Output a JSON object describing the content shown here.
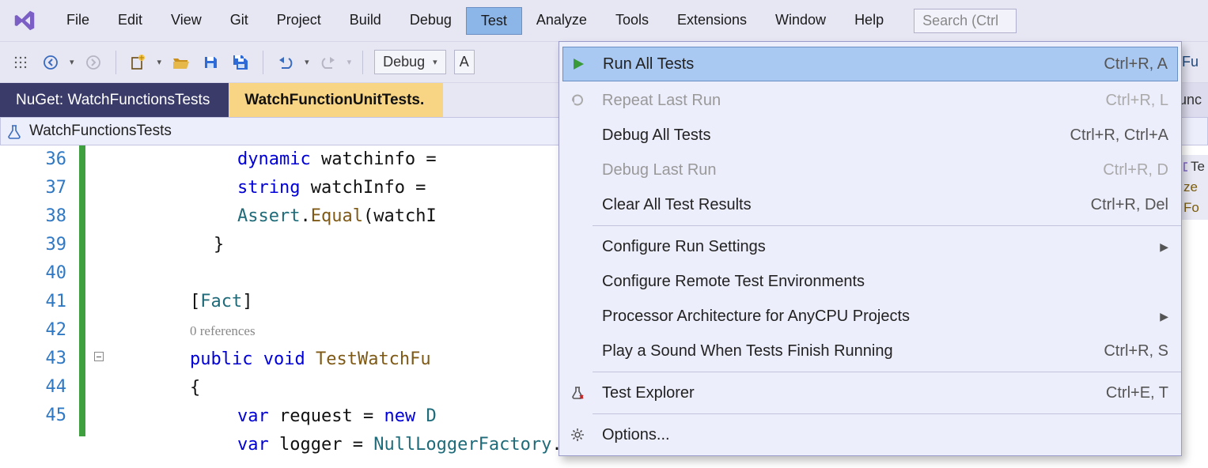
{
  "menubar": {
    "items": [
      "File",
      "Edit",
      "View",
      "Git",
      "Project",
      "Build",
      "Debug",
      "Test",
      "Analyze",
      "Tools",
      "Extensions",
      "Window",
      "Help"
    ],
    "activeIndex": 7,
    "searchPlaceholder": "Search (Ctrl"
  },
  "toolbar": {
    "config": "Debug"
  },
  "tabs": {
    "left": "NuGet: WatchFunctionsTests",
    "active": "WatchFunctionUnitTests.",
    "rightClipped": "unc"
  },
  "breadcrumb": {
    "text": "WatchFunctionsTests"
  },
  "rightPanel": {
    "l1": "Te",
    "l2": "ze",
    "l3": "Fo"
  },
  "editor": {
    "lines": [
      {
        "num": 36,
        "outline": "",
        "html": "<span class='kw'>dynamic</span> watchinfo ="
      },
      {
        "num": 37,
        "outline": "",
        "html": "<span class='kw'>string</span> watchInfo = "
      },
      {
        "num": 38,
        "outline": "",
        "html": "<span class='cls'>Assert</span>.<span class='call'>Equal</span>(watchI"
      },
      {
        "num": 39,
        "outline": "",
        "html": "}",
        "indent": -1
      },
      {
        "num": 40,
        "outline": "",
        "html": ""
      },
      {
        "num": 41,
        "outline": "",
        "html": "[<span class='attr'>Fact</span>]",
        "indent": -2
      },
      {
        "num": "",
        "outline": "",
        "html": "<span class='lens'>0 references</span>",
        "indent": -2
      },
      {
        "num": 42,
        "outline": "box",
        "html": "<span class='kw'>public</span> <span class='kw'>void</span> <span class='call'>TestWatchFu</span>",
        "indent": -2
      },
      {
        "num": 43,
        "outline": "",
        "html": "{",
        "indent": -2
      },
      {
        "num": 44,
        "outline": "",
        "html": "<span class='kw'>var</span> request = <span class='kw'>new</span> <span class='cls'>D</span>"
      },
      {
        "num": 45,
        "outline": "",
        "html": "<span class='kw'>var</span> logger = <span class='cls'>NullLoggerFactory</span>.Instance.<span class='call'>CreateLogger</span>( <span class='err'>Null Logger</span> );"
      }
    ]
  },
  "dropdown": {
    "groups": [
      [
        {
          "icon": "play",
          "label": "Run All Tests",
          "shortcut": "Ctrl+R, A",
          "highlight": true
        },
        {
          "icon": "repeat",
          "label": "Repeat Last Run",
          "shortcut": "Ctrl+R, L",
          "disabled": true
        },
        {
          "icon": "",
          "label": "Debug All Tests",
          "shortcut": "Ctrl+R, Ctrl+A"
        },
        {
          "icon": "",
          "label": "Debug Last Run",
          "shortcut": "Ctrl+R, D",
          "disabled": true
        },
        {
          "icon": "",
          "label": "Clear All Test Results",
          "shortcut": "Ctrl+R, Del"
        }
      ],
      [
        {
          "icon": "",
          "label": "Configure Run Settings",
          "submenu": true
        },
        {
          "icon": "",
          "label": "Configure Remote Test Environments"
        },
        {
          "icon": "",
          "label": "Processor Architecture for AnyCPU Projects",
          "submenu": true
        },
        {
          "icon": "",
          "label": "Play a Sound When Tests Finish Running",
          "shortcut": "Ctrl+R, S"
        }
      ],
      [
        {
          "icon": "flask",
          "label": "Test Explorer",
          "shortcut": "Ctrl+E, T"
        }
      ],
      [
        {
          "icon": "gear",
          "label": "Options..."
        }
      ]
    ]
  }
}
